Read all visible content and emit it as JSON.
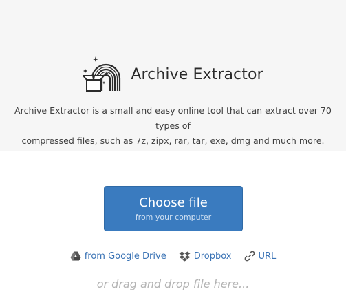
{
  "header": {
    "app_title": "Archive Extractor",
    "description_line1": "Archive Extractor is a small and easy online tool that can extract over 70 types of",
    "description_line2": "compressed files, such as 7z, zipx, rar, tar, exe, dmg and much more.",
    "logo_icon": "rainbow-box-logo"
  },
  "upload": {
    "choose_label": "Choose file",
    "choose_sublabel": "from your computer",
    "sources": [
      {
        "label": "from Google Drive",
        "icon": "google-drive-icon"
      },
      {
        "label": "Dropbox",
        "icon": "dropbox-icon"
      },
      {
        "label": "URL",
        "icon": "link-icon"
      }
    ],
    "drop_hint": "or drag and drop file here..."
  },
  "colors": {
    "hero_bg": "#f6f6f6",
    "button_bg": "#3a7bbf",
    "link": "#3a73b5",
    "hint": "#b3b3b3"
  }
}
